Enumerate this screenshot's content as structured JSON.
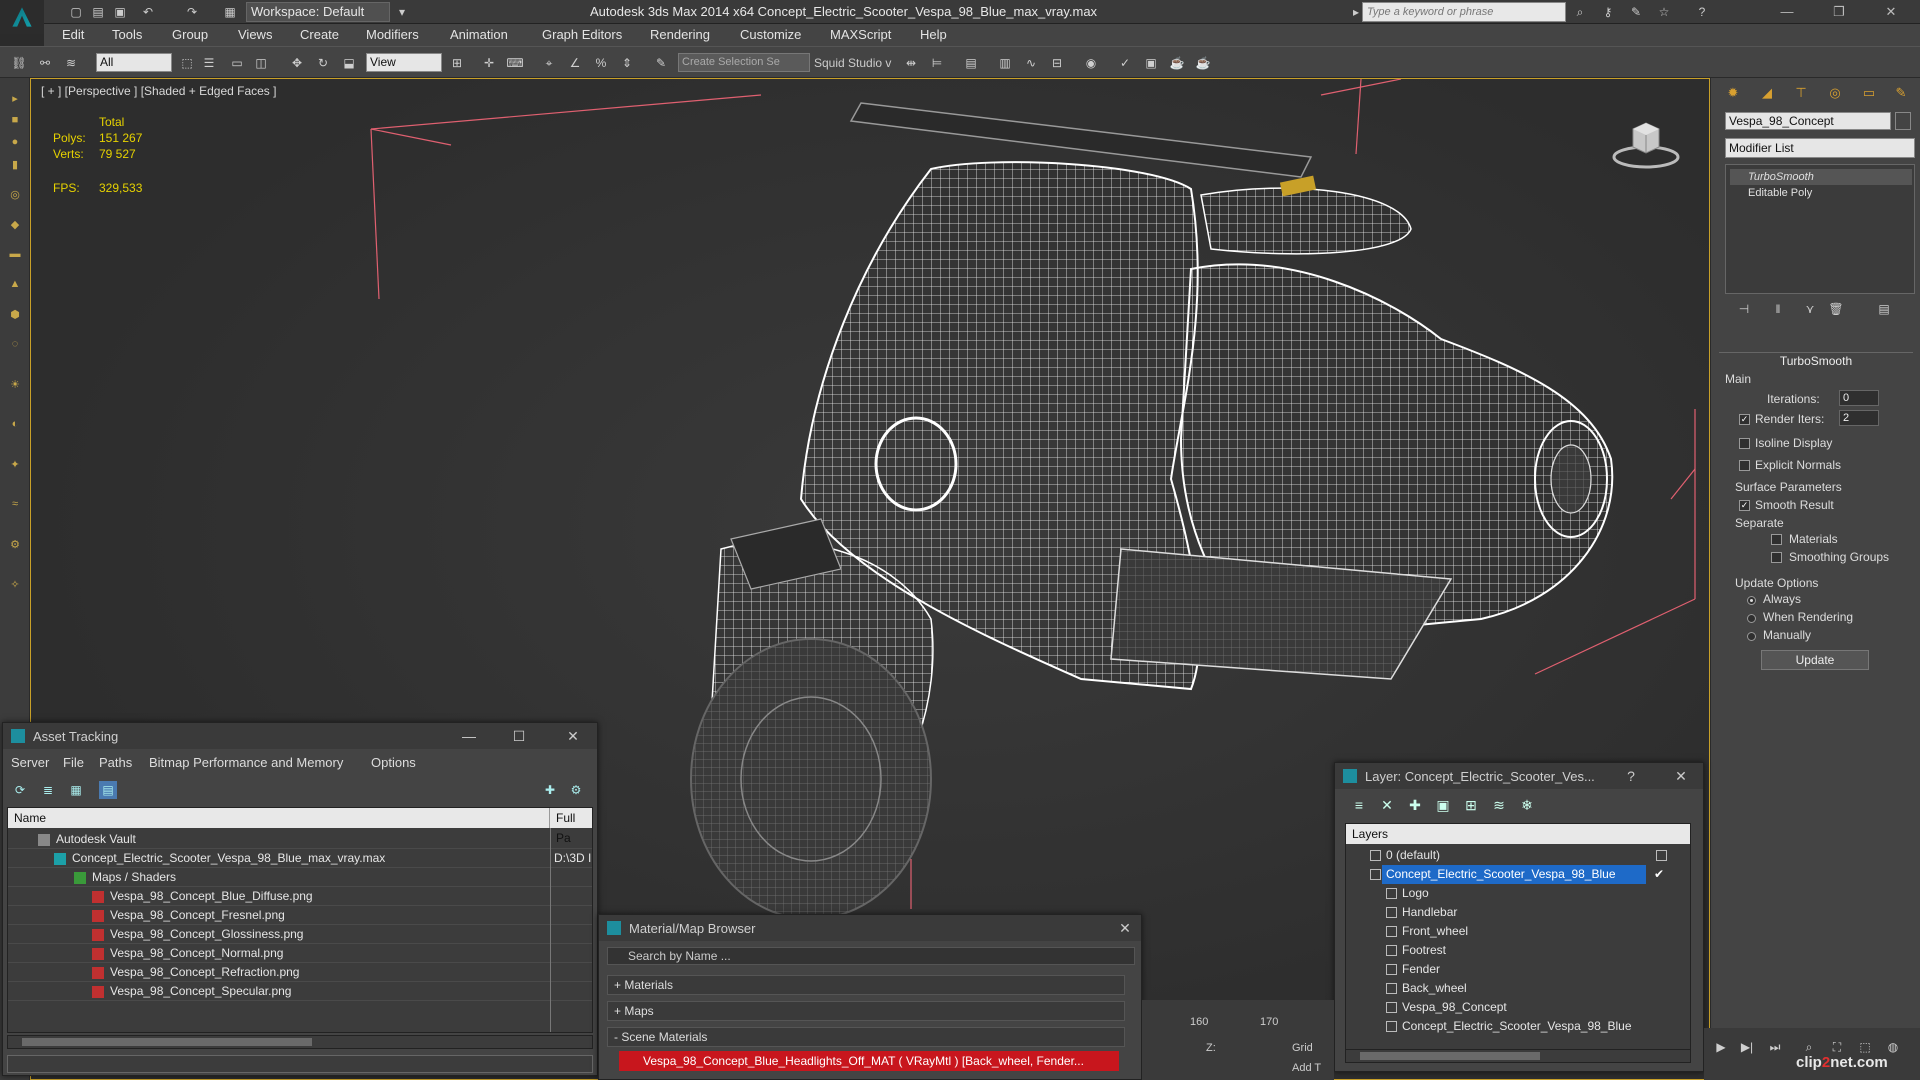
{
  "titlebar": {
    "workspace": "Workspace: Default",
    "title": "Autodesk 3ds Max  2014 x64      Concept_Electric_Scooter_Vespa_98_Blue_max_vray.max",
    "search_placeholder": "Type a keyword or phrase"
  },
  "menu": [
    "Edit",
    "Tools",
    "Group",
    "Views",
    "Create",
    "Modifiers",
    "Animation",
    "Graph Editors",
    "Rendering",
    "Customize",
    "MAXScript",
    "Help"
  ],
  "toolbar": {
    "filter": "All",
    "ref_coord": "View",
    "selection_set": "Create Selection Se",
    "squid": "Squid Studio v"
  },
  "viewport": {
    "label": "[ + ] [Perspective ] [Shaded + Edged Faces ]",
    "stats_total": "Total",
    "polys_label": "Polys:",
    "polys": "151 267",
    "verts_label": "Verts:",
    "verts": "79 527",
    "fps_label": "FPS:",
    "fps": "329,533"
  },
  "command_panel": {
    "object_name": "Vespa_98_Concept",
    "modifier_list": "Modifier List",
    "stack": [
      "TurboSmooth",
      "Editable Poly"
    ],
    "rollout": "TurboSmooth",
    "main": "Main",
    "iterations_label": "Iterations:",
    "iterations": "0",
    "render_iters_label": "Render Iters:",
    "render_iters": "2",
    "isoline": "Isoline Display",
    "explicit_normals": "Explicit Normals",
    "surface_params": "Surface Parameters",
    "smooth_result": "Smooth Result",
    "separate": "Separate",
    "materials": "Materials",
    "smoothing_groups": "Smoothing Groups",
    "update_options": "Update Options",
    "always": "Always",
    "when_rendering": "When Rendering",
    "manually": "Manually",
    "update_btn": "Update"
  },
  "asset_tracking": {
    "title": "Asset Tracking",
    "menu": [
      "Server",
      "File",
      "Paths",
      "Bitmap Performance and Memory",
      "Options"
    ],
    "col_name": "Name",
    "col_path": "Full Pa",
    "rows": [
      {
        "name": "Autodesk Vault",
        "path": ""
      },
      {
        "name": "Concept_Electric_Scooter_Vespa_98_Blue_max_vray.max",
        "path": "D:\\3D I"
      },
      {
        "name": "Maps / Shaders",
        "path": ""
      },
      {
        "name": "Vespa_98_Concept_Blue_Diffuse.png",
        "path": ""
      },
      {
        "name": "Vespa_98_Concept_Fresnel.png",
        "path": ""
      },
      {
        "name": "Vespa_98_Concept_Glossiness.png",
        "path": ""
      },
      {
        "name": "Vespa_98_Concept_Normal.png",
        "path": ""
      },
      {
        "name": "Vespa_98_Concept_Refraction.png",
        "path": ""
      },
      {
        "name": "Vespa_98_Concept_Specular.png",
        "path": ""
      }
    ]
  },
  "material_browser": {
    "title": "Material/Map Browser",
    "search_placeholder": "Search by Name ...",
    "groups": [
      "+ Materials",
      "+ Maps",
      "- Scene Materials"
    ],
    "item": "Vespa_98_Concept_Blue_Headlights_Off_MAT ( VRayMtl ) [Back_wheel, Fender..."
  },
  "layer_dialog": {
    "title": "Layer: Concept_Electric_Scooter_Ves...",
    "help": "?",
    "header": "Layers",
    "rows": [
      "0 (default)",
      "Concept_Electric_Scooter_Vespa_98_Blue",
      "Logo",
      "Handlebar",
      "Front_wheel",
      "Footrest",
      "Fender",
      "Back_wheel",
      "Vespa_98_Concept",
      "Concept_Electric_Scooter_Vespa_98_Blue"
    ]
  },
  "timeline": {
    "ticks": [
      "160",
      "170"
    ],
    "z_label": "Z:",
    "grid_label": "Grid",
    "add_label": "Add T"
  },
  "watermark": {
    "prefix": "clip",
    "accent": "2",
    "suffix": "net.com"
  },
  "colors": {
    "selection_blue": "#1e6ac8",
    "material_red": "#c8161d",
    "stat_yellow": "#e6d200",
    "viewport_border": "#c8a028"
  }
}
